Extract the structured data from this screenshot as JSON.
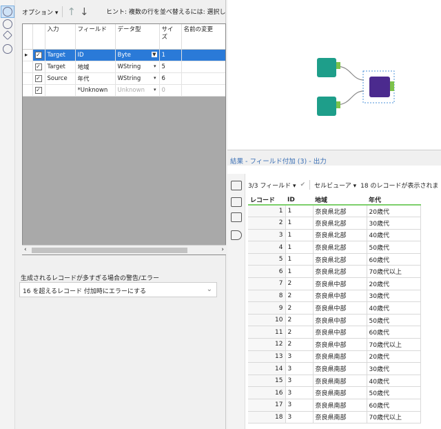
{
  "config": {
    "options_label": "オプション",
    "hint": "ヒント: 複数の行を並べ替えるには: 選択し",
    "columns": [
      "入力",
      "フィールド",
      "データ型",
      "サイズ",
      "名前の変更"
    ],
    "rows": [
      {
        "input": "Target",
        "field": "ID",
        "type": "Byte",
        "size": "1",
        "rename": ""
      },
      {
        "input": "Target",
        "field": "地域",
        "type": "WString",
        "size": "5",
        "rename": ""
      },
      {
        "input": "Source",
        "field": "年代",
        "type": "WString",
        "size": "6",
        "rename": ""
      },
      {
        "input": "",
        "field": "*Unknown",
        "type": "Unknown",
        "size": "0",
        "rename": ""
      }
    ],
    "warn_label": "生成されるレコードが多すぎる場合の警告/エラー",
    "warn_value": "16 を超えるレコード 付加時にエラーにする"
  },
  "results": {
    "title": "結果 - フィールド付加 (3) - 出力",
    "fields_label": "3/3 フィールド",
    "viewer_label": "セルビューア",
    "status": "18 のレコードが表示されま",
    "columns": [
      "レコード",
      "ID",
      "地域",
      "年代"
    ],
    "rows": [
      [
        "1",
        "1",
        "奈良県北部",
        "20歳代"
      ],
      [
        "2",
        "1",
        "奈良県北部",
        "30歳代"
      ],
      [
        "3",
        "1",
        "奈良県北部",
        "40歳代"
      ],
      [
        "4",
        "1",
        "奈良県北部",
        "50歳代"
      ],
      [
        "5",
        "1",
        "奈良県北部",
        "60歳代"
      ],
      [
        "6",
        "1",
        "奈良県北部",
        "70歳代以上"
      ],
      [
        "7",
        "2",
        "奈良県中部",
        "20歳代"
      ],
      [
        "8",
        "2",
        "奈良県中部",
        "30歳代"
      ],
      [
        "9",
        "2",
        "奈良県中部",
        "40歳代"
      ],
      [
        "10",
        "2",
        "奈良県中部",
        "50歳代"
      ],
      [
        "11",
        "2",
        "奈良県中部",
        "60歳代"
      ],
      [
        "12",
        "2",
        "奈良県中部",
        "70歳代以上"
      ],
      [
        "13",
        "3",
        "奈良県南部",
        "20歳代"
      ],
      [
        "14",
        "3",
        "奈良県南部",
        "30歳代"
      ],
      [
        "15",
        "3",
        "奈良県南部",
        "40歳代"
      ],
      [
        "16",
        "3",
        "奈良県南部",
        "50歳代"
      ],
      [
        "17",
        "3",
        "奈良県南部",
        "60歳代"
      ],
      [
        "18",
        "3",
        "奈良県南部",
        "70歳代以上"
      ]
    ]
  }
}
